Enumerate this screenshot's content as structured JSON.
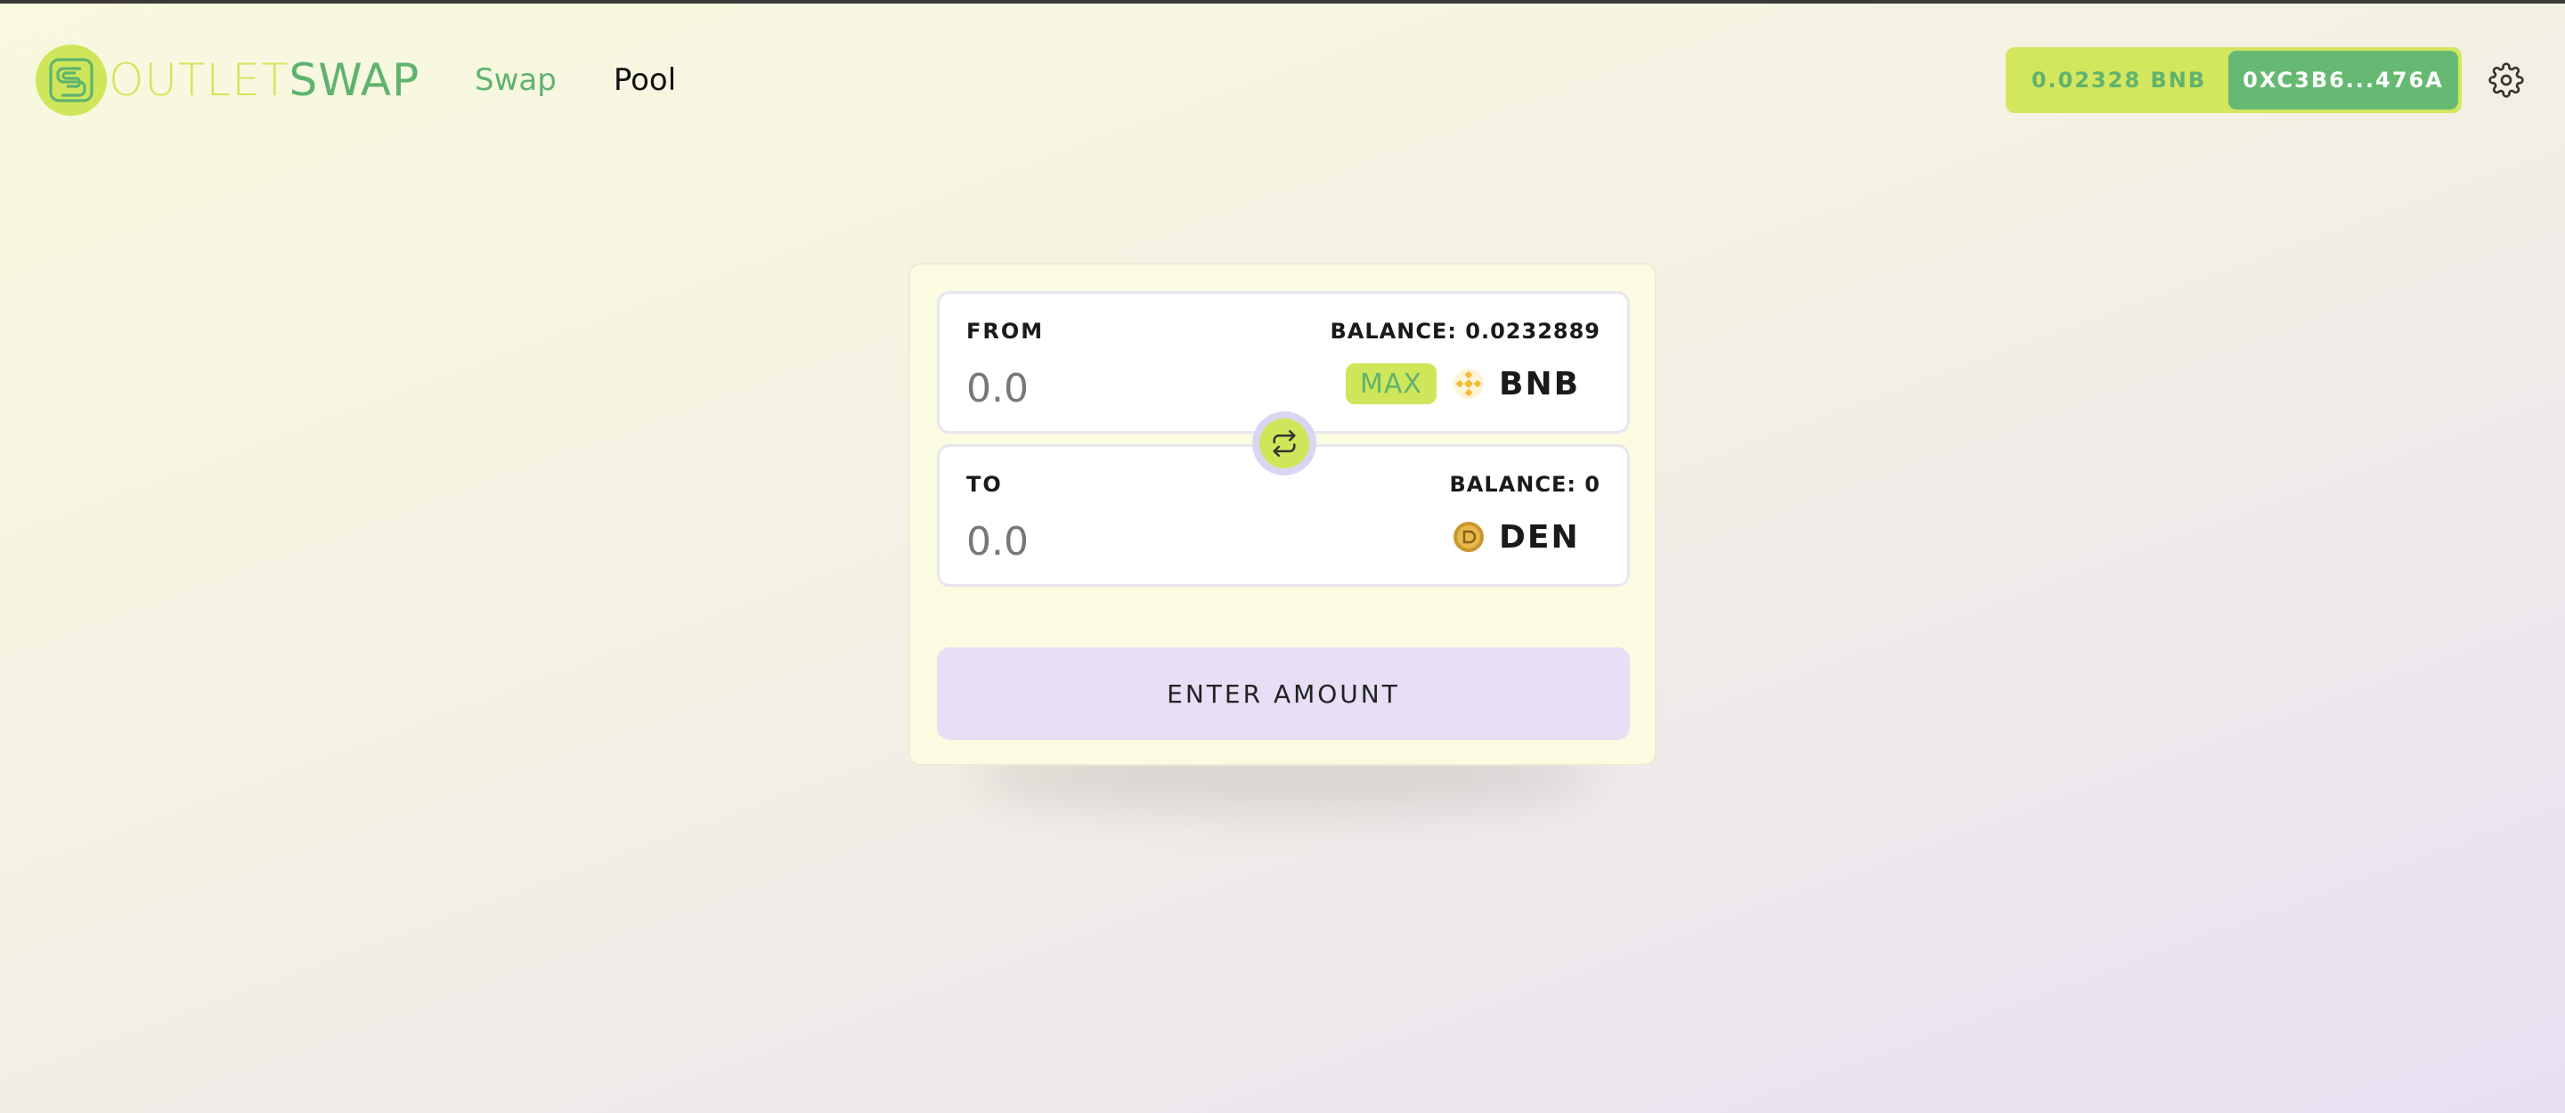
{
  "header": {
    "logo": {
      "part1": "OUTLET",
      "part2": "SWAP"
    },
    "nav": [
      {
        "label": "Swap",
        "active": true
      },
      {
        "label": "Pool",
        "active": false
      }
    ],
    "wallet": {
      "balance": "0.02328 BNB",
      "address": "0XC3B6...476A"
    },
    "settings_icon": "gear-icon"
  },
  "swap": {
    "from": {
      "label": "FROM",
      "balance": "BALANCE: 0.0232889",
      "amount_placeholder": "0.0",
      "max_label": "MAX",
      "token": {
        "symbol": "BNB",
        "icon": "bnb-token-icon"
      }
    },
    "to": {
      "label": "TO",
      "balance": "BALANCE: 0",
      "amount_placeholder": "0.0",
      "token": {
        "symbol": "DEN",
        "icon": "den-token-icon"
      }
    },
    "switch_icon": "swap-arrows-icon",
    "action_label": "ENTER AMOUNT"
  },
  "colors": {
    "accent_lime": "#cfe65a",
    "accent_green": "#5fb36e",
    "button_lavender": "#e6dff5",
    "bnb_yellow": "#f3ba2f"
  }
}
